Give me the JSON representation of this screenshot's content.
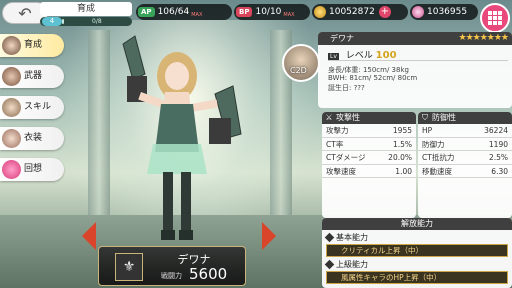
{
  "header": {
    "page_title": "育成",
    "level": "4",
    "progress_text": "0/8",
    "progress_fraction": 0.0
  },
  "resources": {
    "ap_label": "AP",
    "ap_value": "106/64",
    "ap_max": "MAX",
    "bp_label": "BP",
    "bp_value": "10/10",
    "bp_max": "MAX",
    "gold_value": "10052872",
    "gem_value": "1036955",
    "plus": "+"
  },
  "sidebar": {
    "items": [
      {
        "label": "育成",
        "icon": "face-icon"
      },
      {
        "label": "武器",
        "icon": "weapon-icon"
      },
      {
        "label": "スキル",
        "icon": "skill-icon"
      },
      {
        "label": "衣装",
        "icon": "costume-icon"
      },
      {
        "label": "回想",
        "icon": "heart-icon"
      }
    ]
  },
  "nameplate": {
    "name": "デワナ",
    "power_label": "戦闘力",
    "power_value": "5600"
  },
  "profile": {
    "name": "デワナ",
    "stars": "★★★★★★★",
    "c2d": "C2D",
    "level_badge": "Lv",
    "level_label": "レベル",
    "level_value": "100",
    "height_weight": "身長/体重: 150cm/ 38kg",
    "bwh": "BWH: 81cm/ 52cm/ 80cm",
    "birthday": "誕生日: ???"
  },
  "attack": {
    "title": "攻撃性",
    "rows": [
      {
        "k": "攻撃力",
        "v": "1955"
      },
      {
        "k": "CT率",
        "v": "1.5%"
      },
      {
        "k": "CTダメージ",
        "v": "20.0%"
      },
      {
        "k": "攻撃速度",
        "v": "1.00"
      }
    ]
  },
  "defense": {
    "title": "防御性",
    "rows": [
      {
        "k": "HP",
        "v": "36224"
      },
      {
        "k": "防御力",
        "v": "1190"
      },
      {
        "k": "CT抵抗力",
        "v": "2.5%"
      },
      {
        "k": "移動速度",
        "v": "6.30"
      }
    ]
  },
  "abilities": {
    "title": "解放能力",
    "basic_label": "基本能力",
    "basic_value": "クリティカル上昇（中）",
    "advanced_label": "上級能力",
    "advanced_value": "風属性キャラのHP上昇（中）"
  },
  "colors": {
    "accent": "#e9487c",
    "arrow": "#d8452a",
    "gold": "#d6a320"
  }
}
